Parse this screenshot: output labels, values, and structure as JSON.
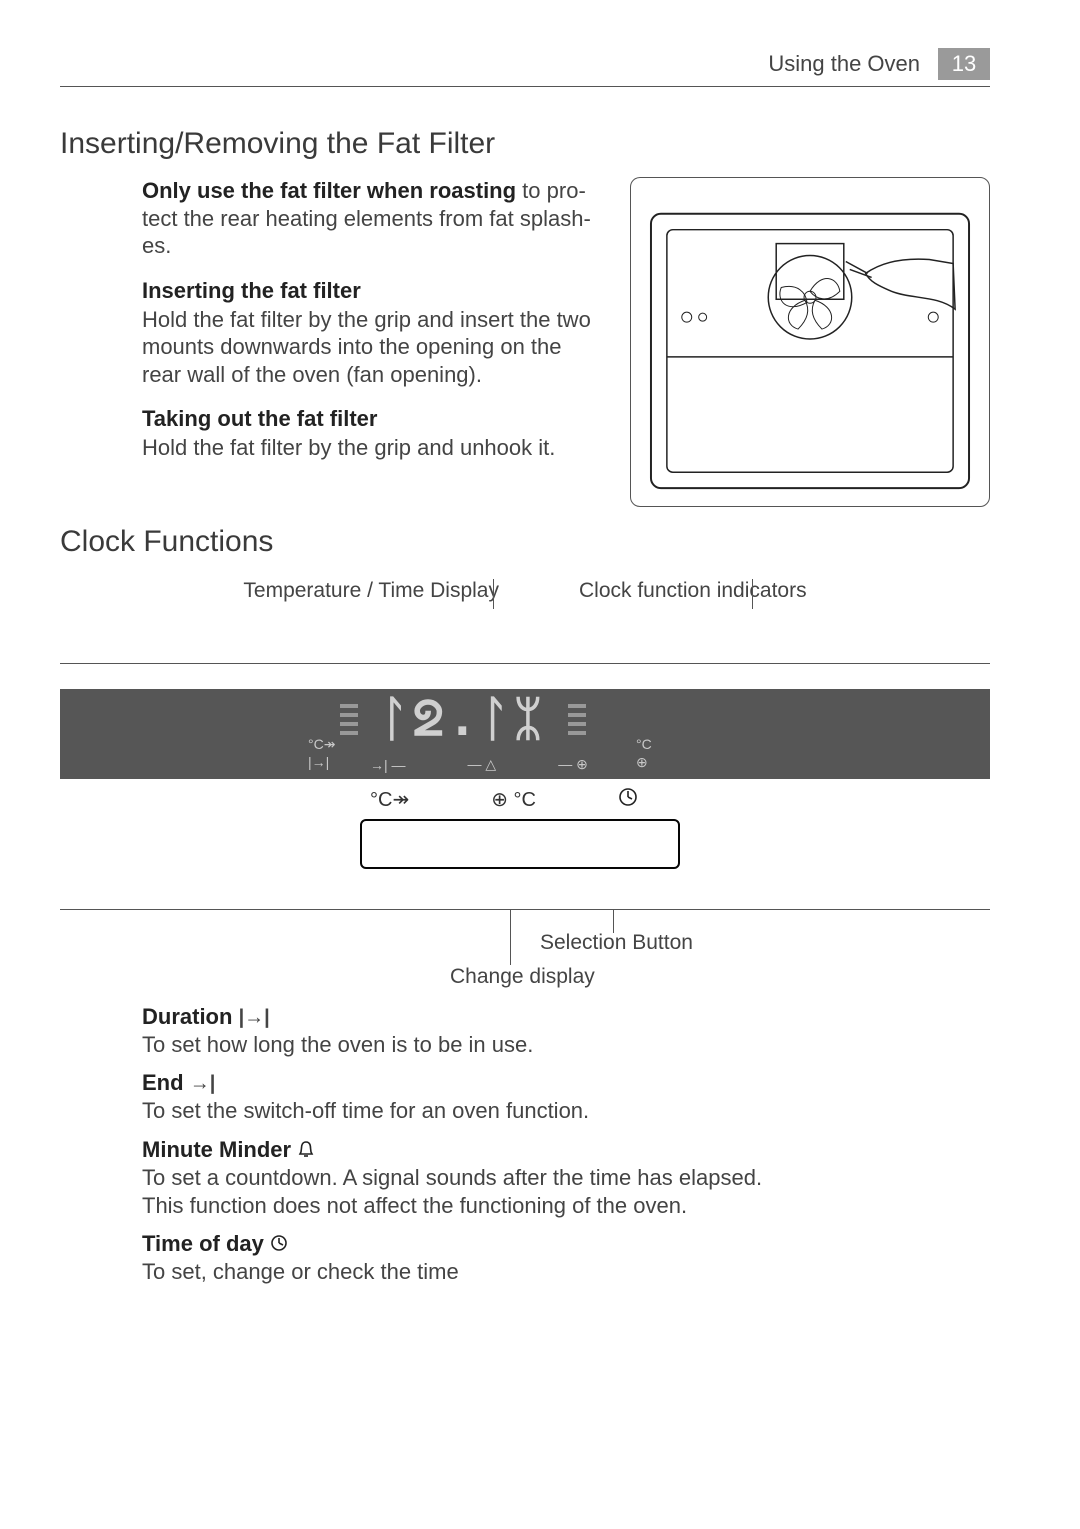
{
  "header": {
    "section_name": "Using the Oven",
    "page_number": "13"
  },
  "sec1": {
    "title": "Inserting/Removing the Fat Filter",
    "p1_strong": "Only use the fat filter when roasting",
    "p1_rest": " to pro­tect the rear heating elements from fat splash­es.",
    "sub1_head": "Inserting the fat filter",
    "sub1_body": "Hold the fat filter by the grip and insert the two mounts downwards into the opening on the rear wall of the oven (fan opening).",
    "sub2_head": "Taking out the fat filter",
    "sub2_body": "Hold the fat filter by the grip and un­hook it."
  },
  "sec2": {
    "title": "Clock Functions",
    "label_temp": "Temperature / Time Display",
    "label_indicators": "Clock function indicators",
    "display_value": "ᛚᘖ.ᛚᛯ",
    "label_selection": "Selection Button",
    "label_change": "Change display",
    "icon_degC_fast": "°C↠",
    "icon_clock_degC": "⊕ °C",
    "icon_clock_small": "⊕",
    "icon_arrow_end": "→| —",
    "icon_dash_bell": "— △",
    "icon_dash_clock": "— ⊕",
    "icon_left1": "°C↠",
    "icon_left2": "|→|",
    "icon_right1": "°C",
    "icon_right2": "⊕"
  },
  "funcs": {
    "duration": {
      "name": "Duration",
      "icon": "|→|",
      "desc": "To set how long the oven is to be in use."
    },
    "end": {
      "name": "End",
      "icon": "→|",
      "desc": "To set the switch-off time for an oven function."
    },
    "minute": {
      "name": "Minute Minder",
      "desc1": "To set a countdown. A signal sounds after the time has elapsed.",
      "desc2": "This function does not affect the functioning of the oven."
    },
    "tod": {
      "name": "Time of day",
      "desc": "To set, change or check the time"
    }
  }
}
